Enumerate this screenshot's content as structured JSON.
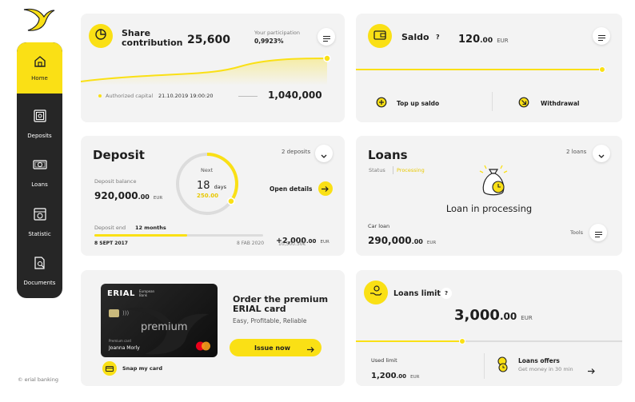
{
  "footer": {
    "brand": "© erial banking"
  },
  "nav": {
    "home": "Home",
    "deposits": "Deposits",
    "loans": "Loans",
    "statistic": "Statistic",
    "documents": "Documents"
  },
  "share": {
    "title_line1": "Share",
    "title_line2": "contribution",
    "value": "25,600",
    "participation_label": "Your participation",
    "participation_value": "0,9923%",
    "authorized_label": "Authorized capital",
    "date": "21.10.2019 19:00:20",
    "authorized_value": "1,040,000"
  },
  "saldo": {
    "title": "Saldo",
    "question": "?",
    "amount_main": "120",
    "amount_dec": ".00",
    "currency": "EUR",
    "top_up": "Top up saldo",
    "withdrawal": "Withdrawal"
  },
  "deposit": {
    "title": "Deposit",
    "count": "2 deposits",
    "balance_label": "Deposit balance",
    "balance_main": "920,000",
    "balance_dec": ".00",
    "balance_currency": "EUR",
    "ring_label": "Next",
    "ring_value": "18",
    "ring_unit": "days",
    "ring_amount": "250.00",
    "ring_progress": 0.35,
    "open_details": "Open details",
    "end_label": "Deposit end",
    "months": "12 months",
    "start_date": "8 SEPT 2017",
    "end_date": "8 FAB 2020",
    "term_progress": 0.55,
    "gain_main": "+2,000",
    "gain_dec": ".00",
    "gain_currency": "EUR",
    "gain_sub": "10,500.50€"
  },
  "loans": {
    "title": "Loans",
    "count": "2 loans",
    "status_label": "Status",
    "status_value": "Processing",
    "processing_text": "Loan in processing",
    "car_label": "Car loan",
    "car_main": "290,000",
    "car_dec": ".00",
    "car_currency": "EUR",
    "tools": "Tools"
  },
  "card": {
    "bank_name": "ERIAL",
    "bank_sub": "European Bank",
    "product": "premium",
    "holder_label": "Premium card",
    "holder": "Joanna Morly",
    "title_line1": "Order the premium",
    "title_line2": "ERIAL card",
    "subtitle": "Easy, Profitable, Reliable",
    "issue_button": "Issue now",
    "snap": "Snap my card"
  },
  "limit": {
    "title": "Loans limit",
    "question": "?",
    "amount_main": "3,000",
    "amount_dec": ".00",
    "currency": "EUR",
    "used_progress": 0.4,
    "used_label": "Used limit",
    "used_main": "1,200",
    "used_dec": ".00",
    "used_currency": "EUR",
    "offers_title": "Loans offers",
    "offers_sub": "Get money in 30 min"
  },
  "colors": {
    "accent": "#fae015",
    "dark": "#262626",
    "card": "#f3f3f3"
  }
}
